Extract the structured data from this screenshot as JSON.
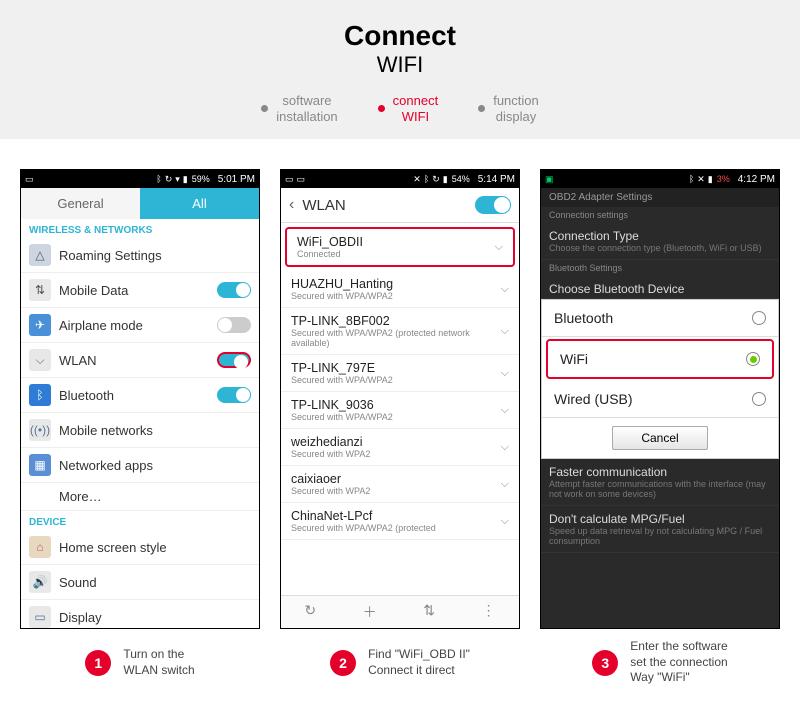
{
  "header": {
    "title": "Connect",
    "subtitle": "WIFI"
  },
  "nav": [
    {
      "label_l1": "software",
      "label_l2": "installation",
      "active": false
    },
    {
      "label_l1": "connect",
      "label_l2": "WIFI",
      "active": true
    },
    {
      "label_l1": "function",
      "label_l2": "display",
      "active": false
    }
  ],
  "phone1": {
    "status": {
      "pct": "59%",
      "time": "5:01 PM"
    },
    "tabs": {
      "general": "General",
      "all": "All"
    },
    "section_wireless": "WIRELESS & NETWORKS",
    "rows": {
      "roaming": "Roaming Settings",
      "mobile_data": "Mobile Data",
      "airplane": "Airplane mode",
      "wlan": "WLAN",
      "bluetooth": "Bluetooth",
      "mobile_networks": "Mobile networks",
      "networked_apps": "Networked apps",
      "more": "More…"
    },
    "section_device": "DEVICE",
    "device_rows": {
      "home": "Home screen style",
      "sound": "Sound",
      "display": "Display"
    }
  },
  "phone2": {
    "status": {
      "pct": "54%",
      "time": "5:14 PM"
    },
    "title": "WLAN",
    "networks": [
      {
        "name": "WiFi_OBDII",
        "sub": "Connected",
        "hi": true
      },
      {
        "name": "HUAZHU_Hanting",
        "sub": "Secured with WPA/WPA2"
      },
      {
        "name": "TP-LINK_8BF002",
        "sub": "Secured with WPA/WPA2 (protected network available)"
      },
      {
        "name": "TP-LINK_797E",
        "sub": "Secured with WPA/WPA2"
      },
      {
        "name": "TP-LINK_9036",
        "sub": "Secured with WPA/WPA2"
      },
      {
        "name": "weizhedianzi",
        "sub": "Secured with WPA2"
      },
      {
        "name": "caixiaoer",
        "sub": "Secured with WPA2"
      },
      {
        "name": "ChinaNet-LPcf",
        "sub": "Secured with WPA/WPA2 (protected"
      }
    ]
  },
  "phone3": {
    "status": {
      "pct": "3%",
      "time": "4:12 PM"
    },
    "hdr": "OBD2 Adapter Settings",
    "sub1": "Connection settings",
    "conn_type": {
      "t": "Connection Type",
      "s": "Choose the connection type (Bluetooth, WiFi or USB)"
    },
    "sub2": "Bluetooth Settings",
    "choose_bt": "Choose Bluetooth Device",
    "options": {
      "bt": "Bluetooth",
      "wifi": "WiFi",
      "wired": "Wired (USB)"
    },
    "cancel": "Cancel",
    "after1": {
      "t": "Faster communication",
      "s": "Attempt faster communications with the interface (may not work on some devices)"
    },
    "after2": {
      "t": "Don't calculate MPG/Fuel",
      "s": "Speed up data retrieval by not calculating MPG / Fuel consumption"
    }
  },
  "captions": [
    {
      "n": "1",
      "l1": "Turn on the",
      "l2": "WLAN switch"
    },
    {
      "n": "2",
      "l1": "Find  \"WiFi_OBD II\"",
      "l2": "Connect it direct"
    },
    {
      "n": "3",
      "l1": "Enter the software",
      "l2": "set the connection",
      "l3": "Way \"WiFi\""
    }
  ]
}
